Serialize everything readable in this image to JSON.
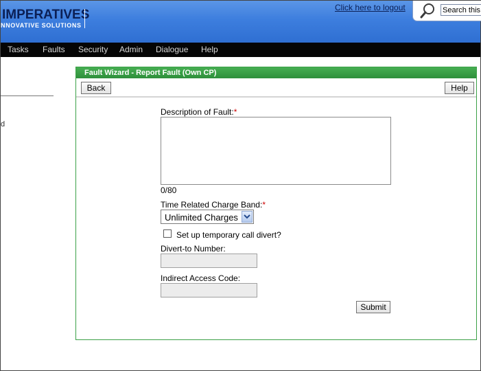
{
  "header": {
    "logo_title": "IMPERATIVES",
    "logo_subtitle": "NNOVATIVE SOLUTIONS",
    "logout_link": "Click here to logout",
    "search_placeholder": "Search this p"
  },
  "nav": {
    "items": [
      {
        "label": "Tasks"
      },
      {
        "label": "Faults"
      },
      {
        "label": "Security"
      },
      {
        "label": "Admin"
      },
      {
        "label": "Dialogue"
      },
      {
        "label": "Help"
      }
    ]
  },
  "left_panel": {
    "fragment": "d"
  },
  "wizard": {
    "title": "Fault Wizard - Report Fault (Own CP)",
    "back_label": "Back",
    "help_label": "Help",
    "description_label": "Description of Fault:",
    "description_value": "",
    "required_marker": "*",
    "char_counter": "0/80",
    "charge_band_label": "Time Related Charge Band:",
    "charge_band_selected": "Unlimited Charges",
    "divert_checkbox_label": "Set up temporary call divert?",
    "divert_checked": false,
    "divert_number_label": "Divert-to Number:",
    "divert_number_value": "",
    "indirect_code_label": "Indirect Access Code:",
    "indirect_code_value": "",
    "submit_label": "Submit"
  },
  "colors": {
    "header_blue": "#3d7ede",
    "nav_black": "#050505",
    "wizard_green": "#3aa046",
    "required_red": "#cc0000"
  }
}
